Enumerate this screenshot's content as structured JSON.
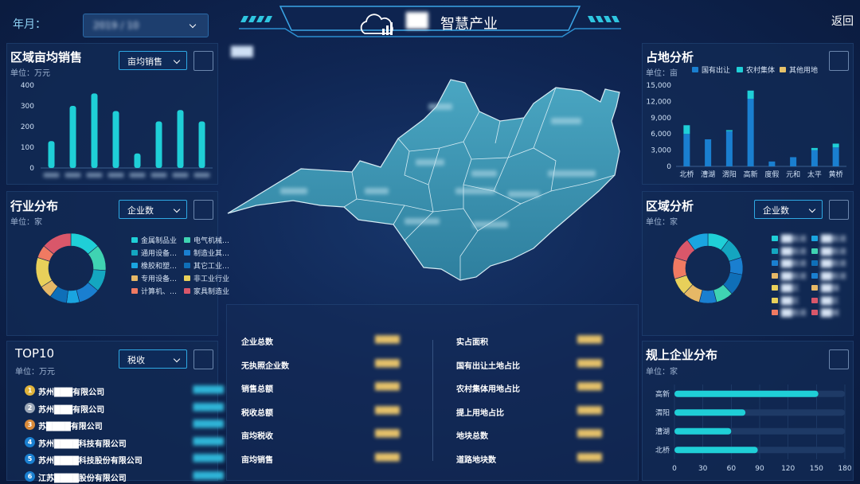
{
  "header": {
    "month_label": "年月：",
    "month_value": "2019 / 10",
    "title_prefix": "██",
    "title": "智慧产业",
    "back": "返回"
  },
  "colors": {
    "cyan": "#1fcfd7",
    "blue": "#1a7fd0",
    "gold": "#e6c26a",
    "panel": "#12294f"
  },
  "region_sales": {
    "title": "区域亩均销售",
    "unit": "单位：万元",
    "select": "亩均销售"
  },
  "industry": {
    "title": "行业分布",
    "unit": "单位：家",
    "select": "企业数",
    "legend": [
      "金属制品业",
      "电气机械…",
      "通用设备…",
      "制造业其…",
      "橡胶和塑…",
      "其它工业…",
      "专用设备…",
      "非工业行业",
      "计算机、…",
      "家具制造业"
    ]
  },
  "top10": {
    "title": "TOP10",
    "unit": "单位：万元",
    "select": "税收",
    "rows": [
      {
        "rank": "1",
        "name": "苏州███有限公司"
      },
      {
        "rank": "2",
        "name": "苏州███有限公司"
      },
      {
        "rank": "3",
        "name": "苏████有限公司"
      },
      {
        "rank": "4",
        "name": "苏州████科技有限公司"
      },
      {
        "rank": "5",
        "name": "苏州████科技股份有限公司"
      },
      {
        "rank": "6",
        "name": "江苏████股份有限公司"
      }
    ]
  },
  "map": {
    "corner_label": "███"
  },
  "stats": {
    "left": [
      "企业总数",
      "无执照企业数",
      "销售总额",
      "税收总额",
      "亩均税收",
      "亩均销售"
    ],
    "right": [
      "实占面积",
      "国有出让土地占比",
      "农村集体用地占比",
      "提上用地占比",
      "地块总数",
      "道路地块数"
    ]
  },
  "land": {
    "title": "占地分析",
    "unit": "单位：亩",
    "legend": [
      "国有出让",
      "农村集体",
      "其他用地"
    ]
  },
  "region": {
    "title": "区域分析",
    "unit": "单位：家",
    "select": "企业数",
    "legend_left": [
      "██街道",
      "██街道",
      "██街道",
      "██街道",
      "██区",
      "██区",
      "██街道"
    ],
    "legend_right": [
      "██街道",
      "██街道",
      "██街道",
      "██街道",
      "██镇",
      "██区",
      "██城"
    ]
  },
  "enterprise": {
    "title": "规上企业分布",
    "unit": "单位：家"
  },
  "chart_data": [
    {
      "type": "bar",
      "ylim": [
        0,
        400
      ],
      "yticks": [
        "0",
        "100",
        "200",
        "300",
        "400"
      ],
      "values": [
        130,
        300,
        360,
        275,
        70,
        225,
        280,
        225
      ]
    },
    {
      "type": "pie",
      "values": [
        14,
        12,
        10,
        10,
        6,
        8,
        6,
        14,
        6,
        14
      ],
      "colors": [
        "#1fcfd7",
        "#3fd3b2",
        "#14a6c0",
        "#1a7fd0",
        "#1aa5e0",
        "#0f6fb8",
        "#e6b866",
        "#e8d05a",
        "#f07a62",
        "#d9576a"
      ]
    },
    {
      "type": "bar",
      "categories": [
        "北桥",
        "漕湖",
        "渭阳",
        "高新",
        "度假",
        "元和",
        "太平",
        "黄桥"
      ],
      "ylim": [
        0,
        15000
      ],
      "yticks": [
        "0",
        "3,000",
        "6,000",
        "9,000",
        "12,000",
        "15,000"
      ],
      "series": [
        {
          "name": "国有出让",
          "values": [
            6000,
            5000,
            6500,
            12500,
            900,
            1700,
            3000,
            3500
          ]
        },
        {
          "name": "农村集体",
          "values": [
            1600,
            0,
            200,
            1500,
            0,
            0,
            400,
            700
          ]
        },
        {
          "name": "其他用地",
          "values": [
            0,
            0,
            0,
            0,
            0,
            0,
            0,
            0
          ]
        }
      ]
    },
    {
      "type": "pie",
      "values": [
        10,
        10,
        8,
        10,
        8,
        8,
        8,
        8,
        10,
        10,
        10
      ],
      "colors": [
        "#1fcfd7",
        "#14a6c0",
        "#1a7fd0",
        "#0f6fb8",
        "#3fd3b2",
        "#1a7fd0",
        "#e6b866",
        "#e8d05a",
        "#f07a62",
        "#d9576a",
        "#1aa5e0"
      ]
    },
    {
      "type": "bar",
      "orientation": "horizontal",
      "categories": [
        "高新",
        "渭阳",
        "漕湖",
        "北桥"
      ],
      "values": [
        152,
        75,
        60,
        88
      ],
      "xlim": [
        0,
        180
      ],
      "xticks": [
        "0",
        "30",
        "60",
        "90",
        "120",
        "150",
        "180"
      ]
    }
  ]
}
